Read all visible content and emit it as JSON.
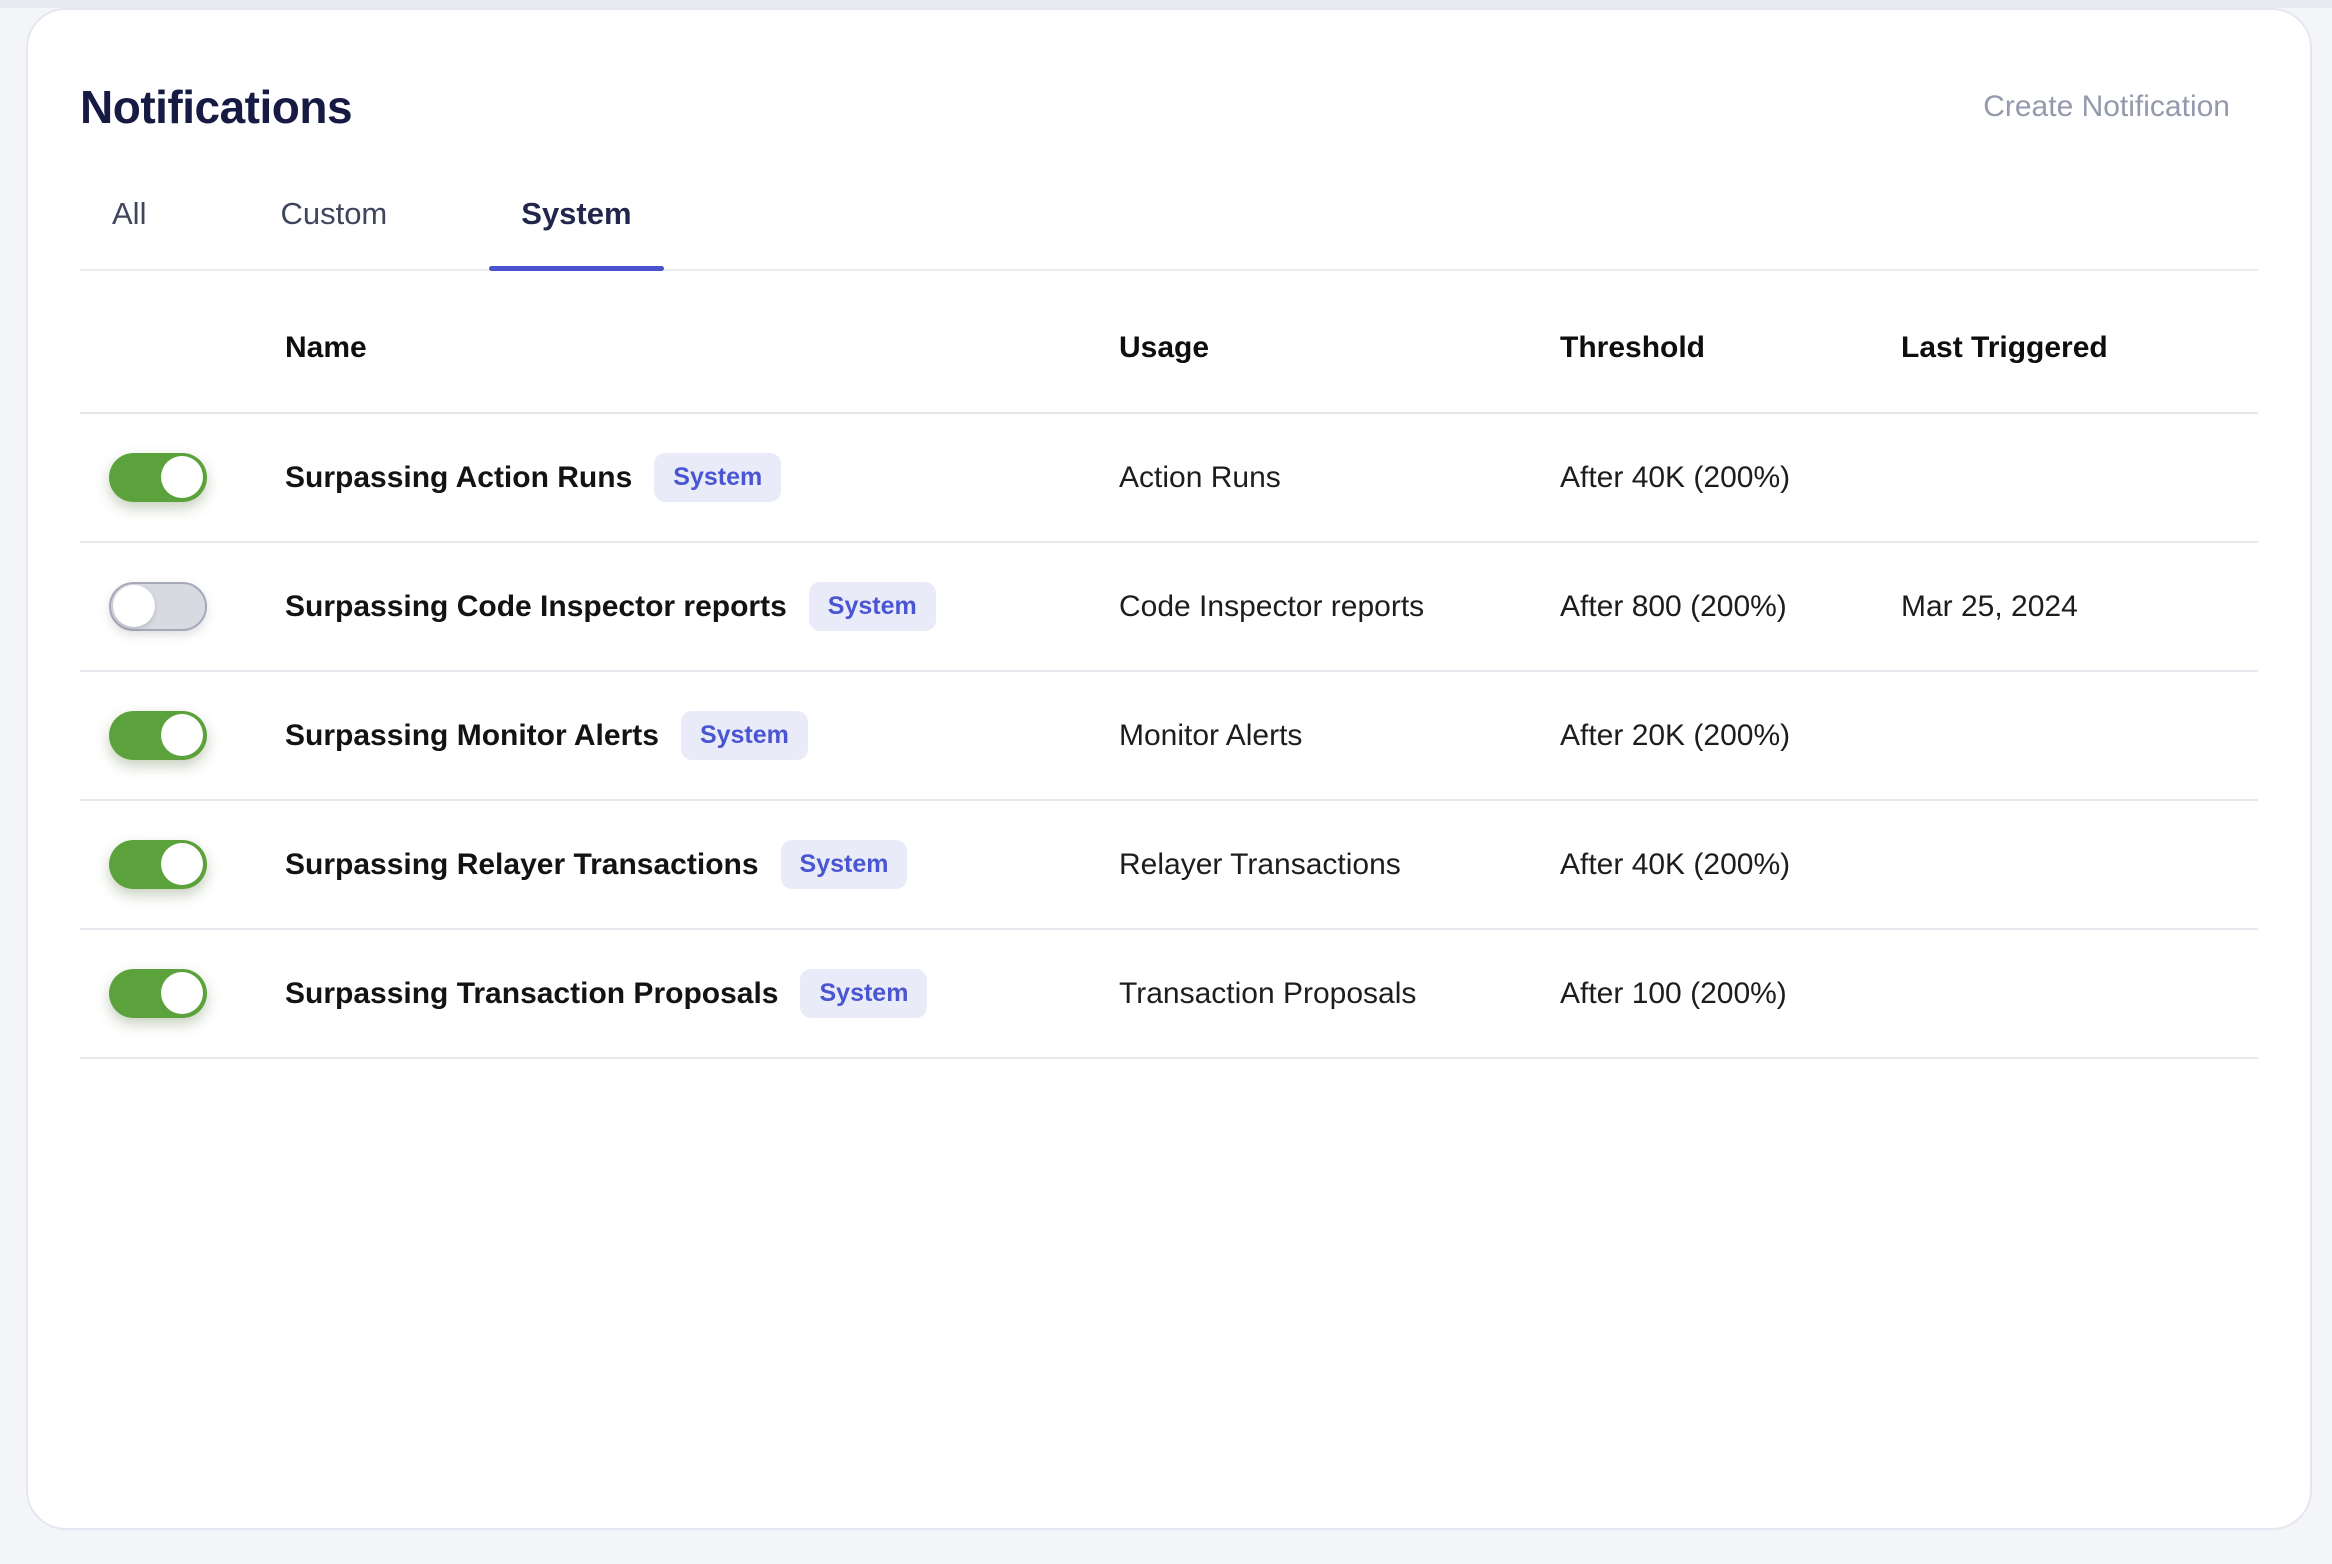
{
  "header": {
    "title": "Notifications",
    "create_button_label": "Create Notification"
  },
  "tabs": [
    {
      "label": "All"
    },
    {
      "label": "Custom"
    },
    {
      "label": "System"
    }
  ],
  "active_tab": "System",
  "table": {
    "columns": {
      "name": "Name",
      "usage": "Usage",
      "threshold": "Threshold",
      "last_triggered": "Last Triggered"
    },
    "rows": [
      {
        "toggle_state": "on",
        "name": "Surpassing Action Runs",
        "badge": "System",
        "usage": "Action Runs",
        "threshold": "After 40K (200%)",
        "last_triggered": ""
      },
      {
        "toggle_state": "off",
        "name": "Surpassing Code Inspector reports",
        "badge": "System",
        "usage": "Code Inspector reports",
        "threshold": "After 800 (200%)",
        "last_triggered": "Mar 25, 2024"
      },
      {
        "toggle_state": "on",
        "name": "Surpassing Monitor Alerts",
        "badge": "System",
        "usage": "Monitor Alerts",
        "threshold": "After 20K (200%)",
        "last_triggered": ""
      },
      {
        "toggle_state": "on",
        "name": "Surpassing Relayer Transactions",
        "badge": "System",
        "usage": "Relayer Transactions",
        "threshold": "After 40K (200%)",
        "last_triggered": ""
      },
      {
        "toggle_state": "on",
        "name": "Surpassing Transaction Proposals",
        "badge": "System",
        "usage": "Transaction Proposals",
        "threshold": "After 100 (200%)",
        "last_triggered": ""
      }
    ]
  },
  "colors": {
    "accent_indigo": "#4a53ce",
    "toggle_on_green": "#5ca23c",
    "toggle_off_gray": "#d8dae2",
    "badge_background": "#e9ebf9",
    "badge_text": "#4a55d2",
    "title_navy": "#171b43",
    "muted_link_gray": "#9499ad"
  }
}
